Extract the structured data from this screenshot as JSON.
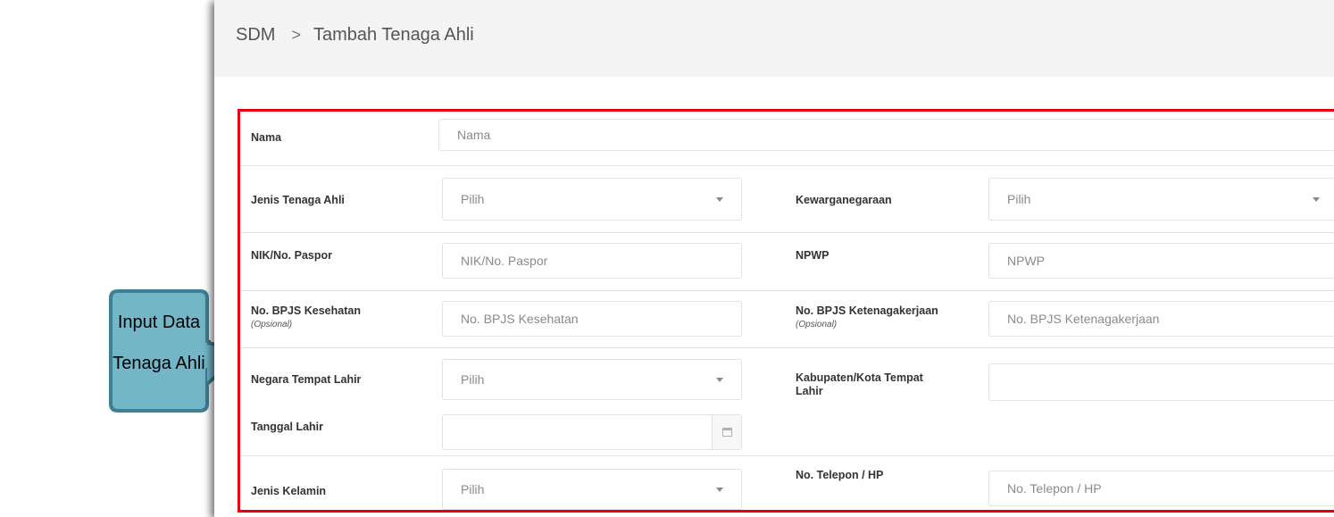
{
  "breadcrumb": {
    "root": "SDM",
    "separator": ">",
    "current": "Tambah Tenaga Ahli"
  },
  "callout": {
    "line1": "Input Data",
    "line2": "Tenaga Ahli"
  },
  "form": {
    "nama": {
      "label": "Nama",
      "placeholder": "Nama"
    },
    "jenis_tenaga_ahli": {
      "label": "Jenis Tenaga Ahli",
      "value": "Pilih"
    },
    "kewarganegaraan": {
      "label": "Kewarganegaraan",
      "value": "Pilih"
    },
    "nik": {
      "label": "NIK/No. Paspor",
      "placeholder": "NIK/No. Paspor"
    },
    "npwp": {
      "label": "NPWP",
      "placeholder": "NPWP"
    },
    "bpjs_kesehatan": {
      "label": "No. BPJS Kesehatan",
      "note": "(Opsional)",
      "placeholder": "No. BPJS Kesehatan"
    },
    "bpjs_ketenagakerjaan": {
      "label": "No. BPJS Ketenagakerjaan",
      "note": "(Opsional)",
      "placeholder": "No. BPJS Ketenagakerjaan"
    },
    "negara_tempat_lahir": {
      "label": "Negara Tempat Lahir",
      "value": "Pilih"
    },
    "kota_tempat_lahir": {
      "label_line1": "Kabupaten/Kota Tempat",
      "label_line2": "Lahir",
      "placeholder": ""
    },
    "tanggal_lahir": {
      "label": "Tanggal Lahir",
      "placeholder": ""
    },
    "jenis_kelamin": {
      "label": "Jenis Kelamin",
      "value": "Pilih"
    },
    "telepon": {
      "label": "No. Telepon / HP",
      "placeholder": "No. Telepon / HP"
    }
  },
  "colors": {
    "highlight_border": "#e4000f",
    "callout_fill": "#73b6c8",
    "callout_border": "#3d7f93"
  },
  "icons": {
    "dropdown": "chevron-down-icon",
    "calendar": "calendar-icon",
    "breadcrumb_separator": "chevron-right-icon"
  }
}
